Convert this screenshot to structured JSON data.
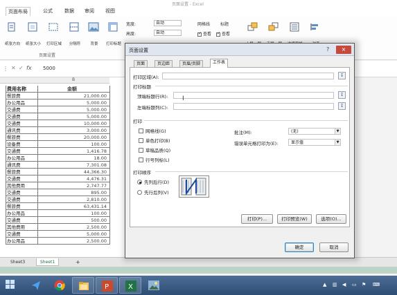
{
  "window": {
    "title": "页面设置 - Excel"
  },
  "ribbon": {
    "tabs": [
      {
        "label": "页面布局",
        "active": true
      },
      {
        "label": "公式",
        "active": false
      },
      {
        "label": "数据",
        "active": false
      },
      {
        "label": "审阅",
        "active": false
      },
      {
        "label": "视图",
        "active": false
      }
    ],
    "buttons": [
      {
        "label": "纸张方向"
      },
      {
        "label": "纸张大小"
      },
      {
        "label": "打印区域"
      },
      {
        "label": "分隔符"
      },
      {
        "label": "背景"
      },
      {
        "label": "打印标题"
      }
    ],
    "group_label": "页面设置",
    "scale": {
      "width_label": "宽度:",
      "width_value": "自动",
      "height_label": "高度:",
      "height_value": "自动",
      "gridlines_label": "网格线",
      "headings_label": "标题",
      "view_label": "查看",
      "view_label2": "查看"
    },
    "arrange": [
      {
        "label": "上移一层"
      },
      {
        "label": "下移一层"
      },
      {
        "label": "选择窗格"
      },
      {
        "label": "对齐"
      }
    ]
  },
  "formula_bar": {
    "fx": "fx",
    "value": "5000"
  },
  "sheet": {
    "column_letter": "B",
    "headers": [
      "费用名称",
      "金额"
    ],
    "rows": [
      [
        "餐旅费",
        "21,000.00"
      ],
      [
        "办公用品",
        "5,000.00"
      ],
      [
        "交通费",
        "5,000.00"
      ],
      [
        "交通费",
        "5,000.00"
      ],
      [
        "交通费",
        "10,000.00"
      ],
      [
        "通讯费",
        "3,000.00"
      ],
      [
        "餐旅费",
        "20,000.00"
      ],
      [
        "设备费",
        "100.00"
      ],
      [
        "交通费",
        "1,416.78"
      ],
      [
        "办公用品",
        "18.00"
      ],
      [
        "通讯费",
        "7,301.08"
      ],
      [
        "餐旅费",
        "44,366.30"
      ],
      [
        "交通费",
        "4,476.31"
      ],
      [
        "其他费用",
        "2,747.77"
      ],
      [
        "交通费",
        "895.00"
      ],
      [
        "交通费",
        "2,810.00"
      ],
      [
        "餐旅费",
        "63,431.14"
      ],
      [
        "办公用品",
        "100.00"
      ],
      [
        "交通费",
        "500.00"
      ],
      [
        "其他费用",
        "2,500.00"
      ],
      [
        "交通费",
        "5,000.00"
      ],
      [
        "办公用品",
        "2,500.00"
      ]
    ],
    "tabs": [
      {
        "label": "Sheet3",
        "active": false
      },
      {
        "label": "Sheet1",
        "active": true
      },
      {
        "label": "+",
        "active": false
      }
    ]
  },
  "dialog": {
    "title": "页面设置",
    "help": "?",
    "close": "×",
    "tabs": [
      {
        "label": "页面",
        "active": false
      },
      {
        "label": "页边距",
        "active": false
      },
      {
        "label": "页眉/页脚",
        "active": false
      },
      {
        "label": "工作表",
        "active": true
      }
    ],
    "print_area_label": "打印区域(A):",
    "print_titles_label": "打印标题",
    "top_rows_label": "顶端标题行(R):",
    "left_cols_label": "左端标题列(C):",
    "print_section_label": "打印",
    "checkboxes": [
      {
        "label": "网格线(G)",
        "checked": false
      },
      {
        "label": "单色打印(B)",
        "checked": false
      },
      {
        "label": "草稿品质(Q)",
        "checked": false
      },
      {
        "label": "行号列标(L)",
        "checked": false
      }
    ],
    "comments_label": "批注(M):",
    "comments_value": "(无)",
    "errors_label": "错误单元格打印为(E):",
    "errors_value": "显示值",
    "order_label": "打印顺序",
    "order_options": [
      {
        "label": "先列后行(D)",
        "selected": true
      },
      {
        "label": "先行后列(V)",
        "selected": false
      }
    ],
    "buttons": {
      "print": "打印(P)...",
      "preview": "打印预览(W)",
      "options": "选项(O)...",
      "ok": "确定",
      "cancel": "取消"
    }
  },
  "taskbar": {
    "apps": [
      {
        "icon": "windows-start-icon"
      },
      {
        "icon": "send-arrow-icon"
      },
      {
        "icon": "chrome-icon"
      },
      {
        "icon": "explorer-icon"
      },
      {
        "icon": "powerpoint-icon"
      },
      {
        "icon": "excel-icon"
      },
      {
        "icon": "photo-viewer-icon"
      }
    ],
    "colors": {
      "accent": "#217346",
      "taskbar": "#3b5b85"
    }
  }
}
